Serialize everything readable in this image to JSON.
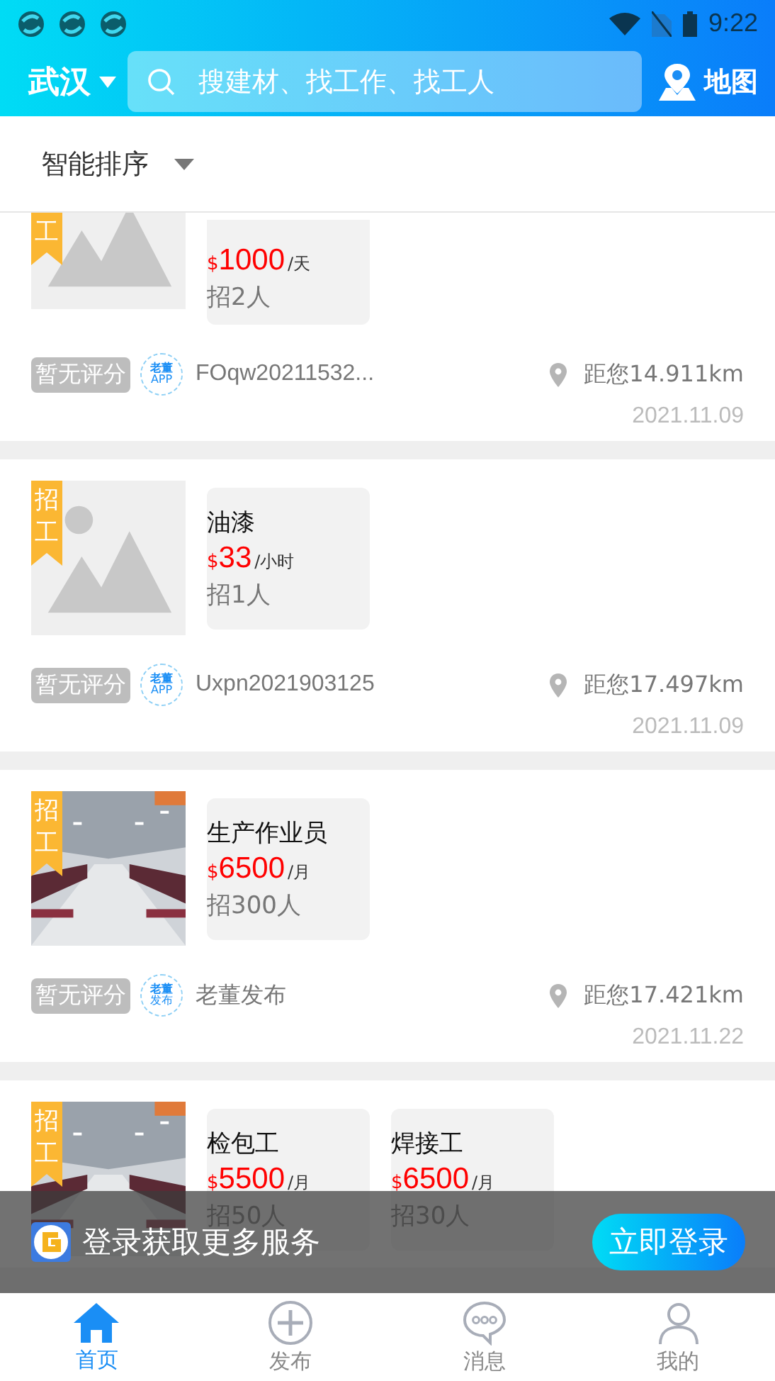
{
  "status_bar": {
    "time": "9:22"
  },
  "header": {
    "city": "武汉",
    "search": {
      "placeholder": "搜建材、找工作、找工人"
    },
    "map_label": "地图"
  },
  "sort": {
    "label": "智能排序"
  },
  "cards": [
    {
      "partial": true,
      "badge": [
        "工"
      ],
      "image": {
        "kind": "placeholder"
      },
      "jobs": [
        {
          "currency": "$",
          "price": "1000",
          "unit": "/天",
          "count": "招2人"
        }
      ],
      "rating": "暂无评分",
      "avatar": [
        "老董",
        "APP"
      ],
      "poster": "FOqw20211532...",
      "distance": "距您14.911km",
      "date": "2021.11.09"
    },
    {
      "partial": false,
      "badge": [
        "招",
        "工"
      ],
      "image": {
        "kind": "placeholder"
      },
      "jobs": [
        {
          "title": "油漆",
          "currency": "$",
          "price": "33",
          "unit": "/小时",
          "count": "招1人"
        }
      ],
      "rating": "暂无评分",
      "avatar": [
        "老董",
        "APP"
      ],
      "poster": "Uxpn2021903125",
      "distance": "距您17.497km",
      "date": "2021.11.09"
    },
    {
      "partial": false,
      "badge": [
        "招",
        "工"
      ],
      "image": {
        "kind": "picture"
      },
      "jobs": [
        {
          "title": "生产作业员",
          "currency": "$",
          "price": "6500",
          "unit": "/月",
          "count": "招300人"
        }
      ],
      "rating": "暂无评分",
      "avatar": [
        "老董",
        "发布"
      ],
      "poster": "老董发布",
      "distance": "距您17.421km",
      "date": "2021.11.22"
    },
    {
      "partial": false,
      "badge": [
        "招",
        "工"
      ],
      "image": {
        "kind": "picture"
      },
      "jobs": [
        {
          "title": "检包工",
          "currency": "$",
          "price": "5500",
          "unit": "/月",
          "count": "招50人"
        },
        {
          "title": "焊接工",
          "currency": "$",
          "price": "6500",
          "unit": "/月",
          "count": "招30人"
        }
      ]
    }
  ],
  "login_banner": {
    "text": "登录获取更多服务",
    "button": "立即登录"
  },
  "tabs": [
    {
      "label": "首页",
      "selected": true
    },
    {
      "label": "发布",
      "selected": false
    },
    {
      "label": "消息",
      "selected": false
    },
    {
      "label": "我的",
      "selected": false
    }
  ]
}
